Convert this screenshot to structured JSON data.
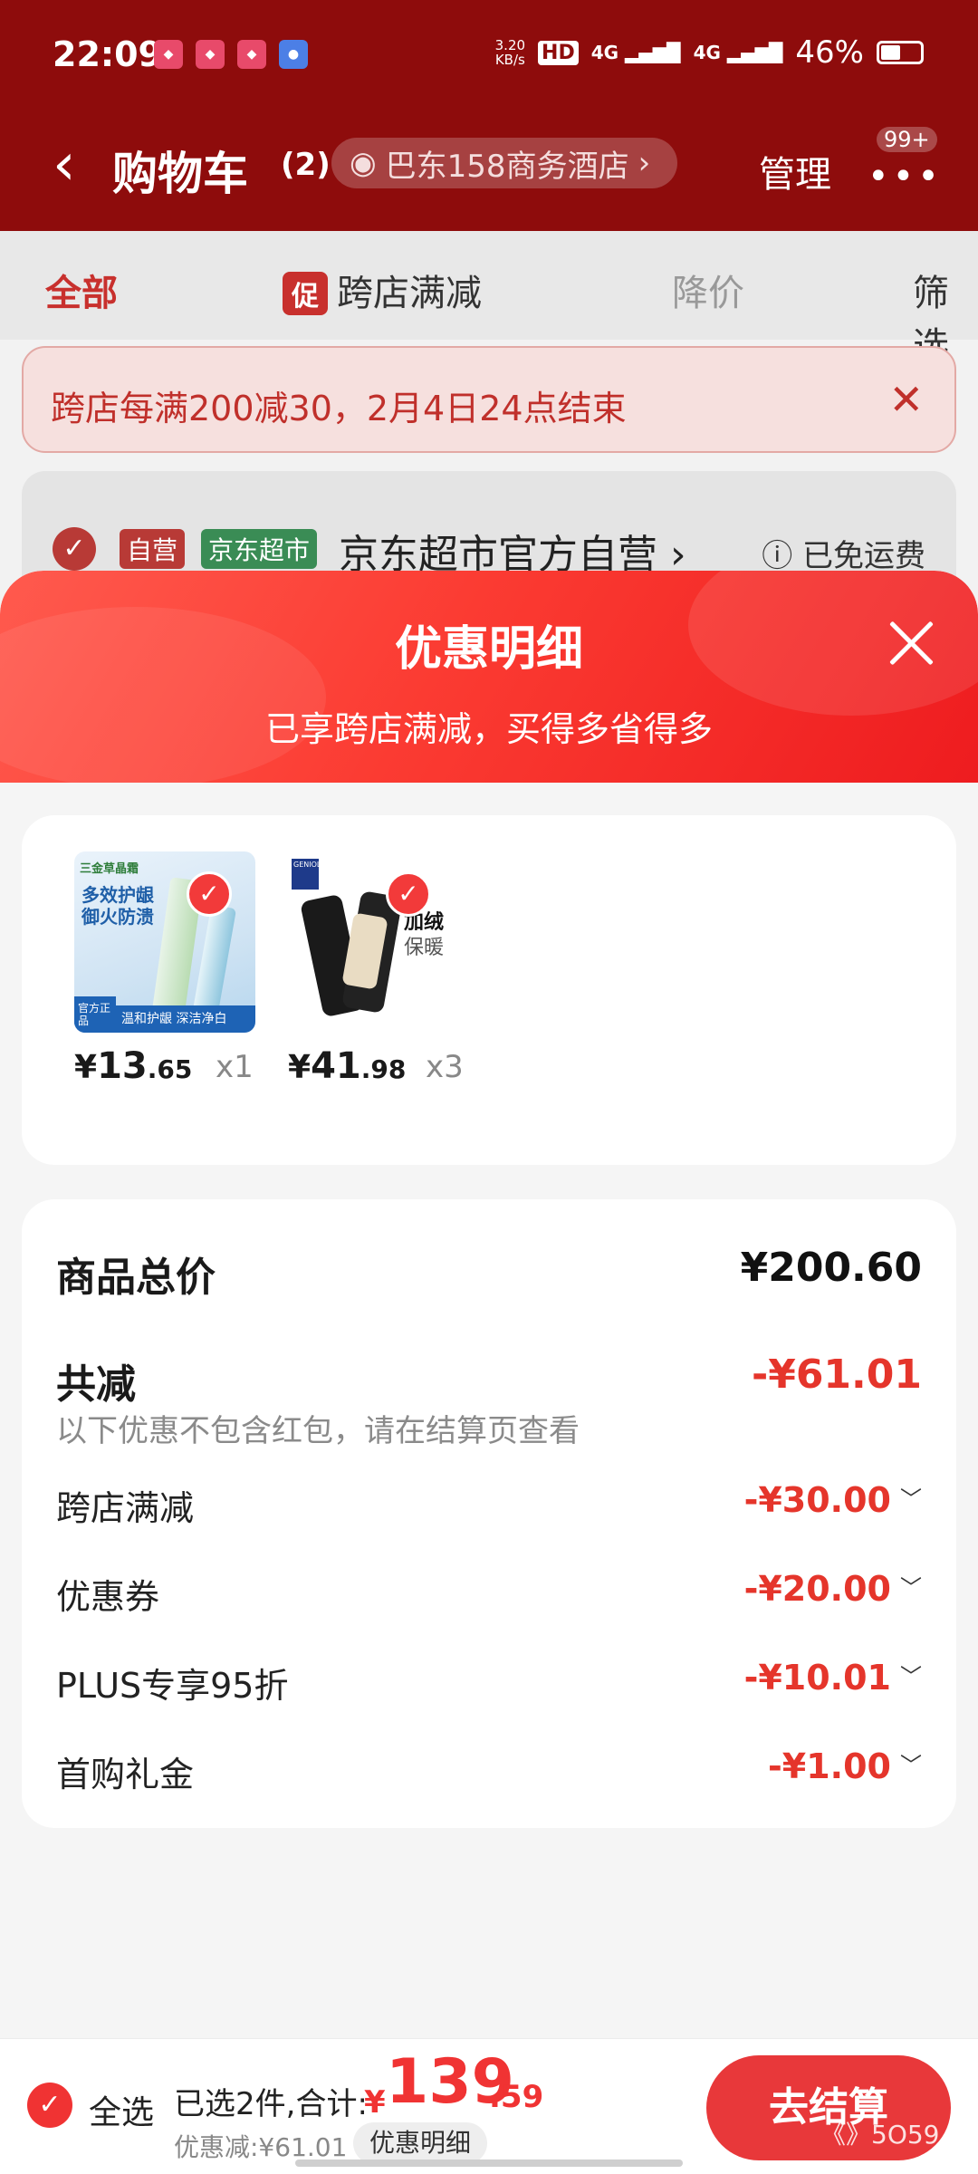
{
  "status_bar": {
    "time": "22:09",
    "net_speed_value": "3.20",
    "net_speed_unit": "KB/s",
    "hd_label": "HD",
    "signal1": "4G",
    "signal2": "4G",
    "battery": "46%",
    "battery_level": 0.46
  },
  "nav": {
    "title": "购物车",
    "count": "(2)",
    "address": "巴东158商务酒店",
    "manage": "管理",
    "badge": "99+"
  },
  "filter_tabs": {
    "all": "全部",
    "promo_tag": "促",
    "cross_store": "跨店满减",
    "price_drop": "降价",
    "filter": "筛选"
  },
  "promo_banner": {
    "text": "跨店每满200减30，2月4日24点结束"
  },
  "store": {
    "tag_self": "自营",
    "tag_market": "京东超市",
    "name": "京东超市官方自营",
    "shipping": "已免运费"
  },
  "sheet": {
    "title": "优惠明细",
    "subtitle": "已享跨店满减，买得多省得多"
  },
  "products": [
    {
      "image_text_brand": "三金草晶霜",
      "image_text_main": "多效护龈 御火防溃",
      "image_text_corner": "官方正品",
      "image_text_bottom": "温和护龈 深洁净白",
      "price_yen": "¥",
      "price_int": "13",
      "price_dec": ".65",
      "qty": "x1"
    },
    {
      "image_text_logo": "GENIOLAMODE",
      "image_text_1": "加绒",
      "image_text_2": "保暖",
      "price_yen": "¥",
      "price_int": "41",
      "price_dec": ".98",
      "qty": "x3"
    }
  ],
  "summary": {
    "total_label": "商品总价",
    "total_value": "¥200.60",
    "reduce_label": "共减",
    "reduce_value": "-¥61.01",
    "note": "以下优惠不包含红包，请在结算页查看",
    "discounts": [
      {
        "label": "跨店满减",
        "value": "-¥30.00"
      },
      {
        "label": "优惠券",
        "value": "-¥20.00"
      },
      {
        "label": "PLUS专享95折",
        "value": "-¥10.01"
      },
      {
        "label": "首购礼金",
        "value": "-¥1.00"
      }
    ]
  },
  "bottom_bar": {
    "select_all": "全选",
    "selected_info": "已选2件,合计:",
    "total_yen": "¥",
    "total_int": "139",
    "total_dec": ".59",
    "discount_info": "优惠减:¥61.01",
    "detail_chip": "优惠明细",
    "checkout": "去结算",
    "watermark": "《》5O59"
  },
  "colors": {
    "brand_red": "#e8383a",
    "header_red": "#8e0c0c",
    "discount_red": "#e5352b"
  }
}
